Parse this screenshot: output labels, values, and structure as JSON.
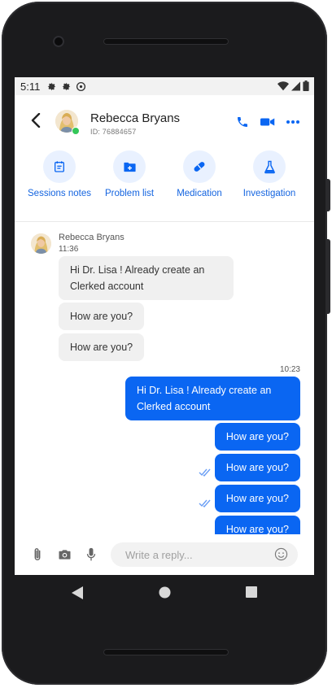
{
  "status_bar": {
    "time": "5:11"
  },
  "header": {
    "patient_name": "Rebecca Bryans",
    "patient_id": "ID: 76884657"
  },
  "actions": [
    {
      "label": "Sessions notes",
      "icon": "notes-icon"
    },
    {
      "label": "Problem list",
      "icon": "folder-plus-icon"
    },
    {
      "label": "Medication",
      "icon": "pill-icon"
    },
    {
      "label": "Investigation",
      "icon": "flask-icon"
    }
  ],
  "colors": {
    "accent": "#0a66f2",
    "action_bg": "#e9f1ff",
    "incoming_bubble": "#f0f0f0"
  },
  "thread": {
    "incoming": {
      "sender": "Rebecca Bryans",
      "time": "11:36",
      "messages": [
        "Hi Dr. Lisa ! Already create an Clerked account",
        "How are you?",
        "How are you?"
      ]
    },
    "outgoing": {
      "time": "10:23",
      "messages": [
        "Hi Dr. Lisa ! Already create an Clerked account",
        "How are you?",
        "How are you?",
        "How are you?",
        "How are you?"
      ]
    }
  },
  "composer": {
    "placeholder": "Write a reply..."
  }
}
